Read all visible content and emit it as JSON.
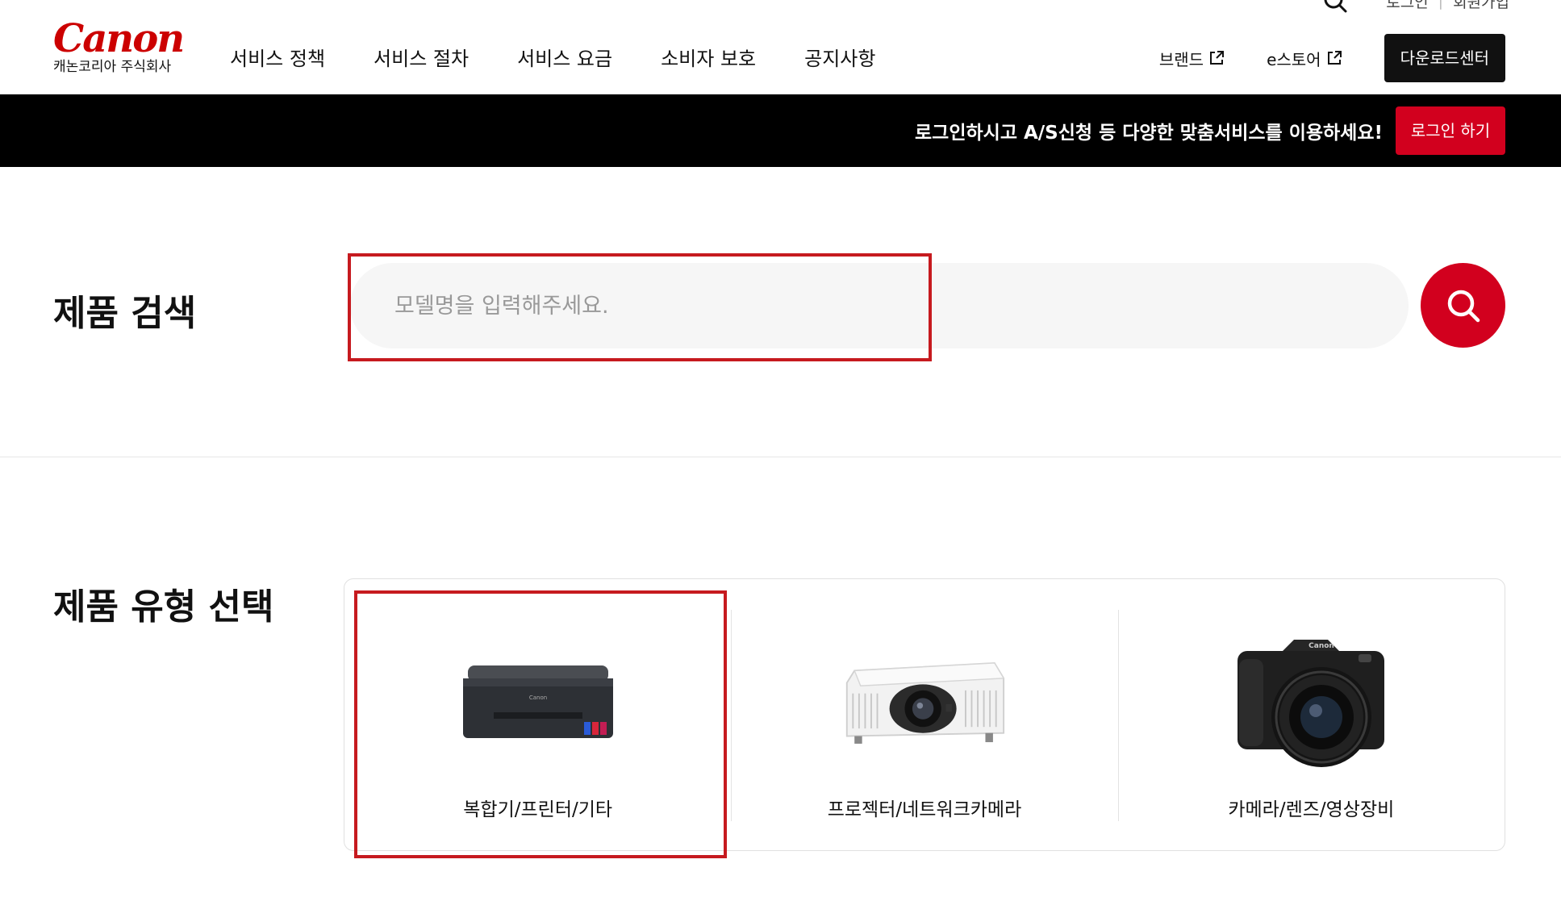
{
  "header": {
    "logo_text": "Canon",
    "logo_sub": "캐논코리아 주식회사",
    "nav": [
      "서비스 정책",
      "서비스 절차",
      "서비스 요금",
      "소비자 보호",
      "공지사항"
    ],
    "util_top": {
      "login": "로그인",
      "signup": "회원가입"
    },
    "brand_link": "브랜드",
    "estore_link": "e스토어",
    "download_center": "다운로드센터"
  },
  "login_bar": {
    "message": "로그인하시고 A/S신청 등 다양한 맞춤서비스를 이용하세요!",
    "button": "로그인 하기"
  },
  "product_search": {
    "title": "제품 검색",
    "placeholder": "모델명을 입력해주세요.",
    "value": ""
  },
  "product_type": {
    "title": "제품 유형 선택",
    "items": [
      {
        "label": "복합기/프린터/기타",
        "icon": "printer-image"
      },
      {
        "label": "프로젝터/네트워크카메라",
        "icon": "projector-image"
      },
      {
        "label": "카메라/렌즈/영상장비",
        "icon": "camera-image"
      }
    ]
  },
  "colors": {
    "brand_red": "#d2001e",
    "highlight": "#c61a1f",
    "login_bar": "#000000"
  }
}
